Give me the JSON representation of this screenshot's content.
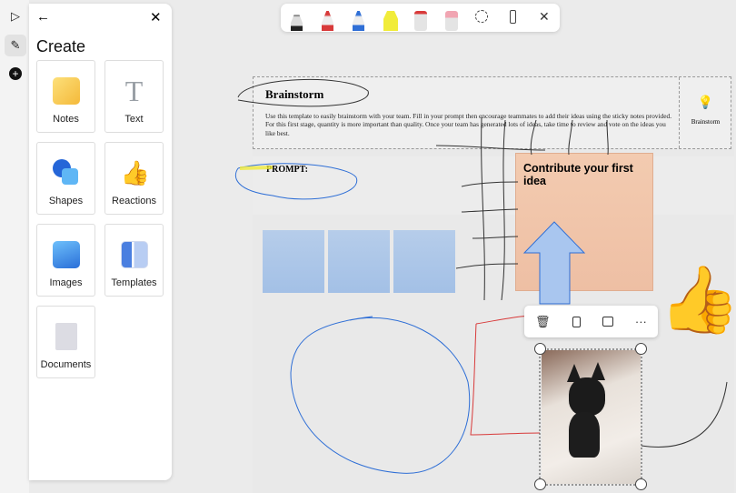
{
  "rail": {
    "icons": [
      "select-icon",
      "pen-icon",
      "add-icon"
    ]
  },
  "panel": {
    "title": "Create",
    "tiles": [
      {
        "label": "Notes",
        "icon": "notes-icon",
        "color": "#f7c948"
      },
      {
        "label": "Text",
        "icon": "text-icon",
        "color": "#9aa0a6"
      },
      {
        "label": "Shapes",
        "icon": "shapes-icon",
        "color": "#2f7de1"
      },
      {
        "label": "Reactions",
        "icon": "thumbs-up-icon",
        "color": "#f5b82e"
      },
      {
        "label": "Images",
        "icon": "image-icon",
        "color": "#3b8ee8"
      },
      {
        "label": "Templates",
        "icon": "templates-icon",
        "color": "#5a8de0"
      },
      {
        "label": "Documents",
        "icon": "document-icon",
        "color": "#c8c8d0"
      }
    ]
  },
  "toolbar": {
    "tools": [
      "black-pen",
      "red-pen",
      "blue-pen",
      "yellow-highlighter",
      "red-marker",
      "eraser",
      "lasso",
      "ruler",
      "close"
    ],
    "colors": {
      "black": "#222222",
      "red": "#d83a3a",
      "blue": "#2f6fd6",
      "yellow": "#f1ec3a"
    }
  },
  "template": {
    "title": "Brainstorm",
    "description": "Use this template to easily brainstorm with your team. Fill in your prompt then encourage teammates to add their ideas using the sticky notes provided. For this first stage, quantity is more important than quality. Once your team has generated lots of ideas, take time to review and vote on the ideas you like best.",
    "side_label": "Brainstorm",
    "prompt": "PROMPT:"
  },
  "note": {
    "text": "Contribute your first idea",
    "color": "#f3cbb0"
  },
  "context_menu": [
    "delete-icon",
    "copy-icon",
    "image-icon",
    "more-icon"
  ],
  "more_label": "···"
}
